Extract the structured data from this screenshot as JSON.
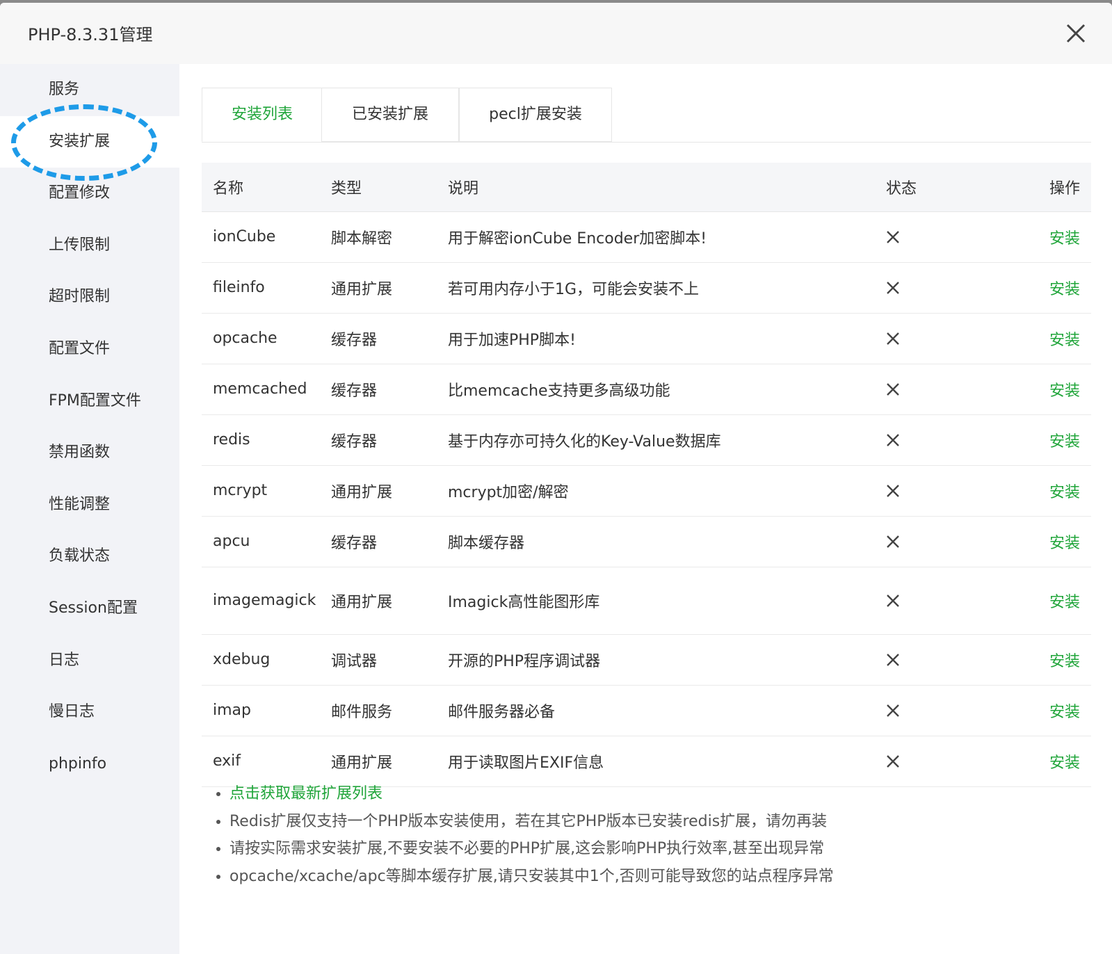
{
  "dialog": {
    "title": "PHP-8.3.31管理"
  },
  "sidebar": {
    "items": [
      {
        "label": "服务"
      },
      {
        "label": "安装扩展",
        "active": true
      },
      {
        "label": "配置修改"
      },
      {
        "label": "上传限制"
      },
      {
        "label": "超时限制"
      },
      {
        "label": "配置文件"
      },
      {
        "label": "FPM配置文件"
      },
      {
        "label": "禁用函数"
      },
      {
        "label": "性能调整"
      },
      {
        "label": "负载状态"
      },
      {
        "label": "Session配置"
      },
      {
        "label": "日志"
      },
      {
        "label": "慢日志"
      },
      {
        "label": "phpinfo"
      }
    ]
  },
  "tabs": [
    {
      "label": "安装列表",
      "active": true
    },
    {
      "label": "已安装扩展"
    },
    {
      "label": "pecl扩展安装"
    }
  ],
  "table": {
    "headers": {
      "name": "名称",
      "type": "类型",
      "desc": "说明",
      "status": "状态",
      "op": "操作"
    },
    "rows": [
      {
        "name": "ionCube",
        "type": "脚本解密",
        "desc": "用于解密ionCube Encoder加密脚本!",
        "status": "not-installed",
        "op": "安装"
      },
      {
        "name": "fileinfo",
        "type": "通用扩展",
        "desc": "若可用内存小于1G，可能会安装不上",
        "status": "not-installed",
        "op": "安装"
      },
      {
        "name": "opcache",
        "type": "缓存器",
        "desc": "用于加速PHP脚本!",
        "status": "not-installed",
        "op": "安装"
      },
      {
        "name": "memcached",
        "type": "缓存器",
        "desc": "比memcache支持更多高级功能",
        "status": "not-installed",
        "op": "安装"
      },
      {
        "name": "redis",
        "type": "缓存器",
        "desc": "基于内存亦可持久化的Key-Value数据库",
        "status": "not-installed",
        "op": "安装"
      },
      {
        "name": "mcrypt",
        "type": "通用扩展",
        "desc": "mcrypt加密/解密",
        "status": "not-installed",
        "op": "安装"
      },
      {
        "name": "apcu",
        "type": "缓存器",
        "desc": "脚本缓存器",
        "status": "not-installed",
        "op": "安装"
      },
      {
        "name": "imagemagick",
        "type": "通用扩展",
        "desc": "Imagick高性能图形库",
        "status": "not-installed",
        "op": "安装"
      },
      {
        "name": "xdebug",
        "type": "调试器",
        "desc": "开源的PHP程序调试器",
        "status": "not-installed",
        "op": "安装"
      },
      {
        "name": "imap",
        "type": "邮件服务",
        "desc": "邮件服务器必备",
        "status": "not-installed",
        "op": "安装"
      },
      {
        "name": "exif",
        "type": "通用扩展",
        "desc": "用于读取图片EXIF信息",
        "status": "not-installed",
        "op": "安装"
      }
    ]
  },
  "notes": {
    "link": "点击获取最新扩展列表",
    "items": [
      "Redis扩展仅支持一个PHP版本安装使用，若在其它PHP版本已安装redis扩展，请勿再装",
      "请按实际需求安装扩展,不要安装不必要的PHP扩展,这会影响PHP执行效率,甚至出现异常",
      "opcache/xcache/apc等脚本缓存扩展,请只安装其中1个,否则可能导致您的站点程序异常"
    ]
  },
  "colors": {
    "accent": "#20a53a",
    "highlight": "#1e9be8"
  }
}
